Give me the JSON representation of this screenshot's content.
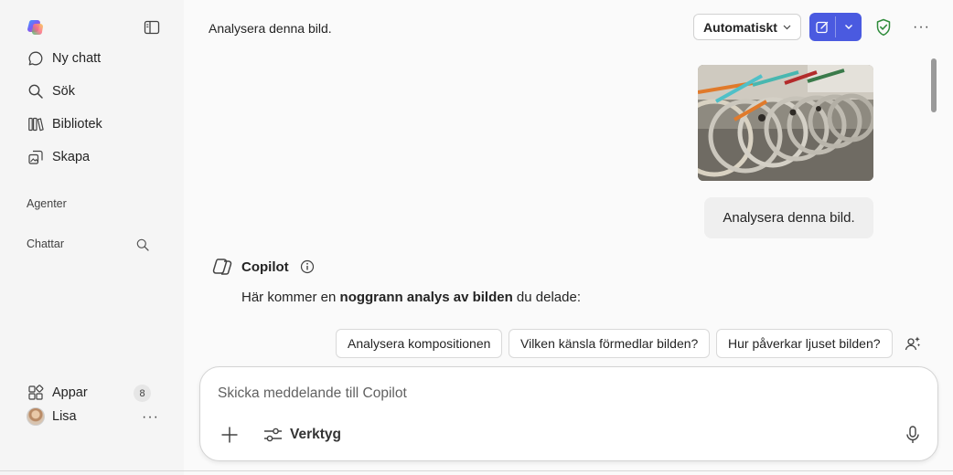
{
  "sidebar": {
    "items": [
      {
        "label": "Ny chatt",
        "icon": "chat-bubble-icon"
      },
      {
        "label": "Sök",
        "icon": "search-icon"
      },
      {
        "label": "Bibliotek",
        "icon": "library-icon"
      },
      {
        "label": "Skapa",
        "icon": "create-icon"
      }
    ],
    "agents_label": "Agenter",
    "chats_label": "Chattar",
    "apps_label": "Appar",
    "apps_count": "8",
    "user_name": "Lisa",
    "more": "···"
  },
  "header": {
    "title": "Analysera denna bild.",
    "mode": "Automatiskt",
    "more": "···"
  },
  "conversation": {
    "user_message": "Analysera denna bild.",
    "assistant_name": "Copilot",
    "answer_prefix": "Här kommer en ",
    "answer_bold": "noggrann analys av bilden",
    "answer_suffix": " du delade:"
  },
  "suggestions": [
    "Analysera kompositionen",
    "Vilken känsla förmedlar bilden?",
    "Hur påverkar ljuset bilden?"
  ],
  "composer": {
    "placeholder": "Skicka meddelande till Copilot",
    "tools_label": "Verktyg"
  },
  "colors": {
    "accent": "#4a5ae0",
    "shield": "#2e8b3a",
    "sidebar_bg": "#f5f5f5"
  }
}
